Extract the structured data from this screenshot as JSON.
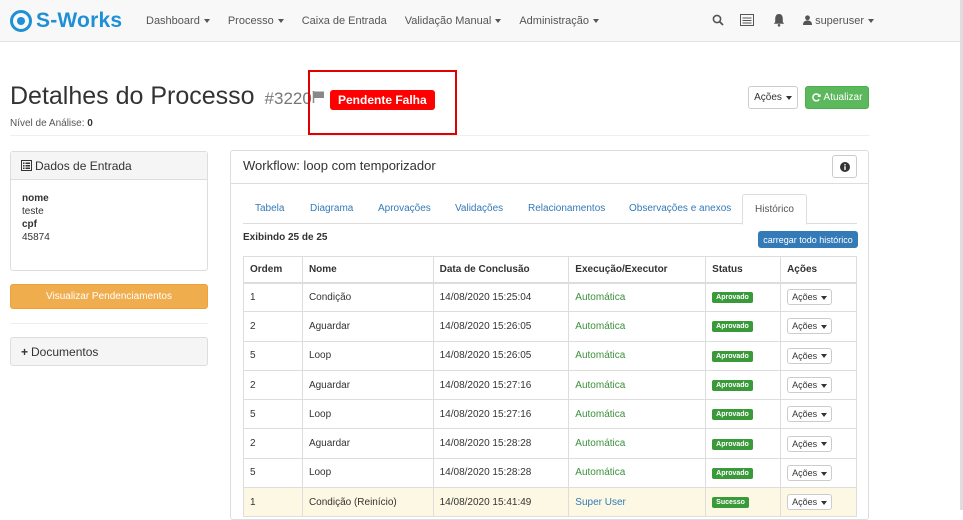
{
  "app": {
    "brand": "S-Works"
  },
  "nav": {
    "items": [
      {
        "label": "Dashboard",
        "dropdown": true
      },
      {
        "label": "Processo",
        "dropdown": true
      },
      {
        "label": "Caixa de Entrada",
        "dropdown": false
      },
      {
        "label": "Validação Manual",
        "dropdown": true
      },
      {
        "label": "Administração",
        "dropdown": true
      }
    ],
    "icons": [
      "search-icon",
      "list-icon",
      "bell-icon"
    ],
    "user": "superuser"
  },
  "header": {
    "title": "Detalhes do Processo",
    "process_id": "#3220",
    "status": "Pendente Falha",
    "nivel_label": "Nível de Análise:",
    "nivel_value": "0",
    "acoes_label": "Ações",
    "atualizar_label": "Atualizar"
  },
  "entrada": {
    "title": "Dados de Entrada",
    "fields": [
      {
        "key": "nome",
        "value": "teste"
      },
      {
        "key": "cpf",
        "value": "45874"
      }
    ]
  },
  "left": {
    "pendenciamentos_label": "Visualizar Pendenciamentos",
    "documentos_label": "Documentos"
  },
  "workflow": {
    "title": "Workflow: loop com temporizador",
    "tabs": [
      "Tabela",
      "Diagrama",
      "Aprovações",
      "Validações",
      "Relacionamentos",
      "Observações e anexos",
      "Histórico"
    ],
    "active_tab": "Histórico",
    "exibindo": "Exibindo 25 de 25",
    "carregar_label": "carregar todo histórico",
    "columns": [
      "Ordem",
      "Nome",
      "Data de Conclusão",
      "Execução/Executor",
      "Status",
      "Ações"
    ],
    "rows": [
      {
        "ordem": "1",
        "nome": "Condição",
        "data": "14/08/2020 15:25:04",
        "exec": "Automática",
        "status": "Aprovado",
        "acoes": "Ações"
      },
      {
        "ordem": "2",
        "nome": "Aguardar",
        "data": "14/08/2020 15:26:05",
        "exec": "Automática",
        "status": "Aprovado",
        "acoes": "Ações"
      },
      {
        "ordem": "5",
        "nome": "Loop",
        "data": "14/08/2020 15:26:05",
        "exec": "Automática",
        "status": "Aprovado",
        "acoes": "Ações"
      },
      {
        "ordem": "2",
        "nome": "Aguardar",
        "data": "14/08/2020 15:27:16",
        "exec": "Automática",
        "status": "Aprovado",
        "acoes": "Ações"
      },
      {
        "ordem": "5",
        "nome": "Loop",
        "data": "14/08/2020 15:27:16",
        "exec": "Automática",
        "status": "Aprovado",
        "acoes": "Ações"
      },
      {
        "ordem": "2",
        "nome": "Aguardar",
        "data": "14/08/2020 15:28:28",
        "exec": "Automática",
        "status": "Aprovado",
        "acoes": "Ações"
      },
      {
        "ordem": "5",
        "nome": "Loop",
        "data": "14/08/2020 15:28:28",
        "exec": "Automática",
        "status": "Aprovado",
        "acoes": "Ações"
      },
      {
        "ordem": "1",
        "nome": "Condição (Reinício)",
        "data": "14/08/2020 15:41:49",
        "exec": "Super User",
        "status": "Sucesso",
        "acoes": "Ações"
      }
    ]
  },
  "colors": {
    "brand": "#1e90d6",
    "status_red": "#ff0000",
    "success_green": "#5cb85c",
    "link_blue": "#337ab7",
    "warning_orange": "#f0ad4e",
    "badge_green": "#3a9a3a"
  }
}
